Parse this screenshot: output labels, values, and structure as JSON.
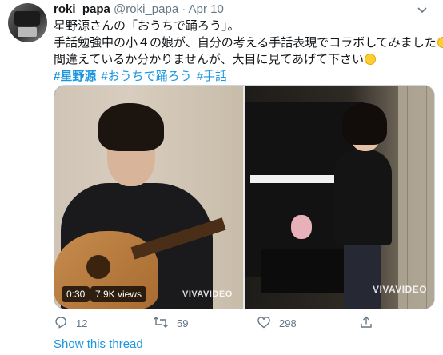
{
  "tweet": {
    "author": {
      "name": "roki_papa",
      "handle": "@roki_papa",
      "separator": "·",
      "date": "Apr 10"
    },
    "text": {
      "line1": "星野源さんの「おうちで踊ろう」。",
      "line2": "手話勉強中の小４の娘が、自分の考える手話表現でコラボしてみました",
      "line3": "間違えているか分かりませんが、大目に見てあげて下さい"
    },
    "hashtags": [
      "#星野源",
      "#おうちで踊ろう",
      "#手話"
    ],
    "media": {
      "duration": "0:30",
      "views": "7.9K views",
      "watermark_left": "VIVAVIDEO",
      "watermark_right": "VIVAVIDEO"
    },
    "actions": {
      "replies": "12",
      "retweets": "59",
      "likes": "298"
    },
    "show_thread": "Show this thread"
  },
  "colors": {
    "link": "#1b95e0",
    "secondary": "#657786",
    "text": "#14171a"
  },
  "icons": [
    "chevron-down-icon",
    "reply-icon",
    "retweet-icon",
    "like-icon",
    "share-icon"
  ]
}
